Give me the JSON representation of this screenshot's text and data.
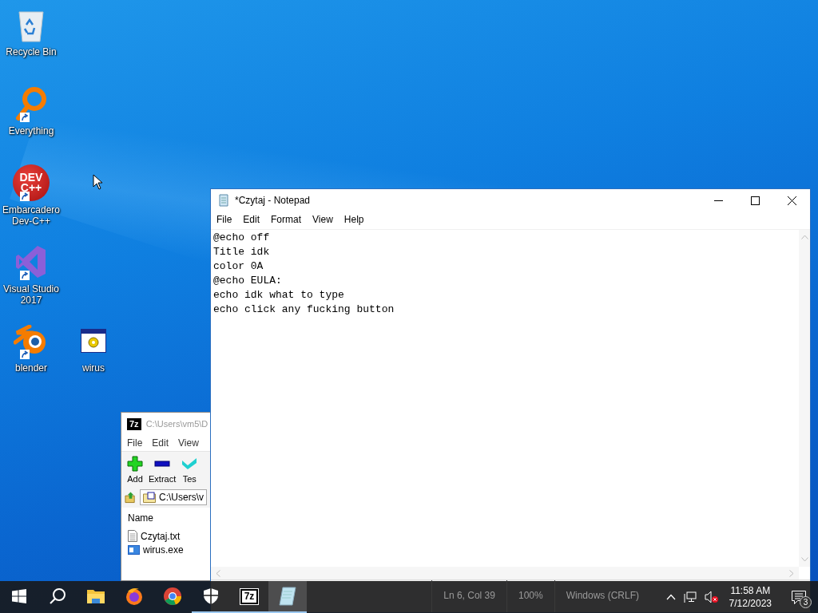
{
  "desktop_icon_rows": [
    [
      {
        "label": "Recycle Bin",
        "kind": "recycle",
        "shortcut": false
      }
    ],
    [
      {
        "label": "Everything",
        "kind": "magnifier",
        "shortcut": true
      }
    ],
    [
      {
        "label": "Embarcadero Dev-C++",
        "kind": "devcpp",
        "icon_text": [
          "DEV",
          "C++"
        ],
        "shortcut": true
      }
    ],
    [
      {
        "label": "Visual Studio 2017",
        "kind": "vs",
        "shortcut": true
      }
    ],
    [
      {
        "label": "blender",
        "kind": "blender",
        "shortcut": true
      },
      {
        "label": "wirus",
        "kind": "exe",
        "shortcut": false
      }
    ]
  ],
  "archive_window": {
    "icon_text": "7z",
    "title": "C:\\Users\\vm5\\D",
    "menu": [
      "File",
      "Edit",
      "View"
    ],
    "toolbar": [
      {
        "label": "Add",
        "kind": "add"
      },
      {
        "label": "Extract",
        "kind": "extract"
      },
      {
        "label": "Tes",
        "kind": "test"
      }
    ],
    "path": "C:\\Users\\v",
    "columns": [
      "Name"
    ],
    "files": [
      {
        "name": "Czytaj.txt",
        "kind": "text"
      },
      {
        "name": "wirus.exe",
        "kind": "exe"
      }
    ]
  },
  "notepad": {
    "title": "*Czytaj - Notepad",
    "menu": [
      "File",
      "Edit",
      "Format",
      "View",
      "Help"
    ],
    "lines": [
      "@echo off",
      "Title idk",
      "color 0A",
      "@echo EULA:",
      "echo idk what to type",
      "echo click any fucking button"
    ],
    "status_bar": [
      "Ln 6, Col 39",
      "100%",
      "Windows (CRLF)"
    ]
  },
  "taskbar": {
    "items": [
      {
        "kind": "start",
        "running": false,
        "selected": false
      },
      {
        "kind": "search",
        "running": false,
        "selected": false
      },
      {
        "kind": "explorer",
        "running": false,
        "selected": false
      },
      {
        "kind": "firefox",
        "running": false,
        "selected": false
      },
      {
        "kind": "chrome",
        "running": false,
        "selected": false
      },
      {
        "kind": "shield",
        "running": true,
        "selected": false
      },
      {
        "kind": "sevenzip",
        "label": "7z",
        "running": true,
        "selected": false
      },
      {
        "kind": "notepad",
        "running": true,
        "selected": true
      }
    ],
    "time": "11:58 AM",
    "date": "7/12/2023",
    "notification_count": "3"
  }
}
